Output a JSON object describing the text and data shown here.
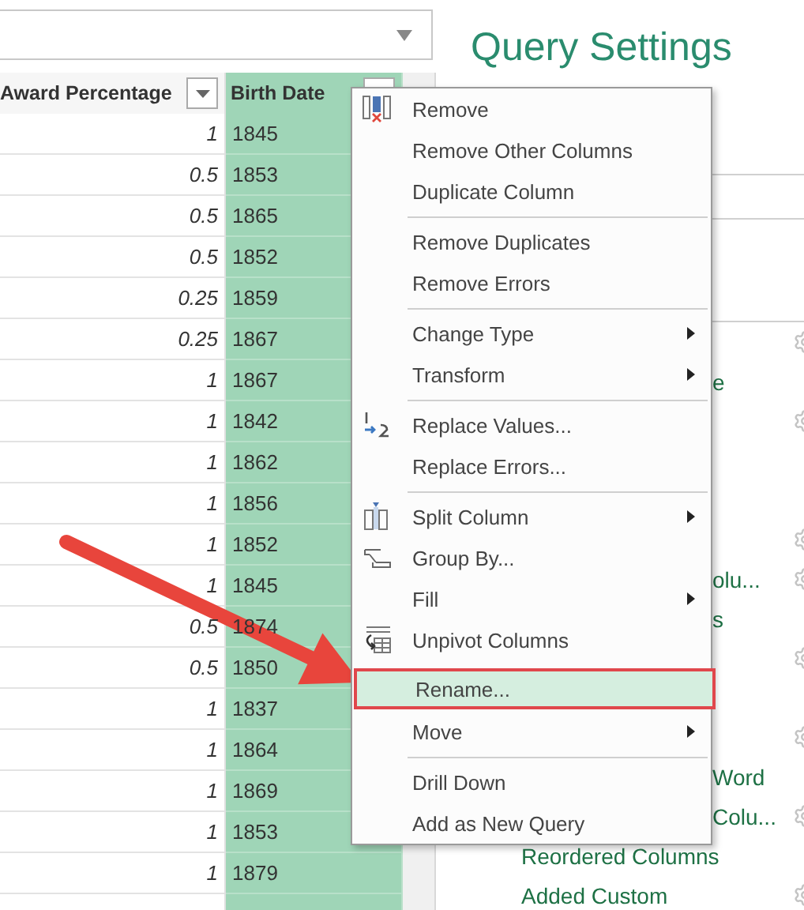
{
  "table": {
    "columns": [
      {
        "label": "Award Percentage",
        "highlighted": false
      },
      {
        "label": "Birth Date",
        "highlighted": true
      }
    ],
    "rows": [
      [
        "1",
        "1845"
      ],
      [
        "0.5",
        "1853"
      ],
      [
        "0.5",
        "1865"
      ],
      [
        "0.5",
        "1852"
      ],
      [
        "0.25",
        "1859"
      ],
      [
        "0.25",
        "1867"
      ],
      [
        "1",
        "1867"
      ],
      [
        "1",
        "1842"
      ],
      [
        "1",
        "1862"
      ],
      [
        "1",
        "1856"
      ],
      [
        "1",
        "1852"
      ],
      [
        "1",
        "1845"
      ],
      [
        "0.5",
        "1874"
      ],
      [
        "0.5",
        "1850"
      ],
      [
        "1",
        "1837"
      ],
      [
        "1",
        "1864"
      ],
      [
        "1",
        "1869"
      ],
      [
        "1",
        "1853"
      ],
      [
        "1",
        "1879"
      ]
    ]
  },
  "query_settings": {
    "title": "Query Settings",
    "steps": [
      {
        "gear": true
      },
      {
        "label": "e",
        "kind": "partial",
        "gear": false
      },
      {
        "gear": true
      },
      {
        "gear": false
      },
      {
        "gear": false
      },
      {
        "gear": true
      },
      {
        "label": "olu...",
        "kind": "partial",
        "gear": true
      },
      {
        "label": "s",
        "kind": "partial",
        "gear": false
      },
      {
        "gear": true
      },
      {
        "gear": false
      },
      {
        "gear": true
      },
      {
        "label": "Word",
        "kind": "partial",
        "gear": false
      },
      {
        "label": "Colu...",
        "kind": "partial",
        "gear": true
      },
      {
        "label": "Reordered Columns",
        "kind": "full",
        "gear": false
      },
      {
        "label": "Added Custom",
        "kind": "full",
        "gear": true
      }
    ]
  },
  "context_menu": {
    "items": [
      {
        "kind": "remove",
        "label": "Remove",
        "submenu": false,
        "selected": false
      },
      {
        "kind": "item",
        "label": "Remove Other Columns",
        "submenu": false,
        "selected": false
      },
      {
        "kind": "item",
        "label": "Duplicate Column",
        "submenu": false,
        "selected": false
      },
      {
        "kind": "separator"
      },
      {
        "kind": "item",
        "label": "Remove Duplicates",
        "submenu": false,
        "selected": false
      },
      {
        "kind": "item",
        "label": "Remove Errors",
        "submenu": false,
        "selected": false
      },
      {
        "kind": "separator"
      },
      {
        "kind": "item",
        "label": "Change Type",
        "submenu": true,
        "selected": false
      },
      {
        "kind": "item",
        "label": "Transform",
        "submenu": true,
        "selected": false
      },
      {
        "kind": "separator"
      },
      {
        "kind": "replace",
        "label": "Replace Values...",
        "submenu": false,
        "selected": false
      },
      {
        "kind": "item",
        "label": "Replace Errors...",
        "submenu": false,
        "selected": false
      },
      {
        "kind": "separator"
      },
      {
        "kind": "split",
        "label": "Split Column",
        "submenu": true,
        "selected": false
      },
      {
        "kind": "group",
        "label": "Group By...",
        "submenu": false,
        "selected": false
      },
      {
        "kind": "item",
        "label": "Fill",
        "submenu": true,
        "selected": false
      },
      {
        "kind": "unpivot",
        "label": "Unpivot Columns",
        "submenu": false,
        "selected": false
      },
      {
        "kind": "item",
        "label": "Rename...",
        "submenu": false,
        "selected": true
      },
      {
        "kind": "item",
        "label": "Move",
        "submenu": true,
        "selected": false
      },
      {
        "kind": "separator"
      },
      {
        "kind": "item",
        "label": "Drill Down",
        "submenu": false,
        "selected": false
      },
      {
        "kind": "item",
        "label": "Add as New Query",
        "submenu": false,
        "selected": false
      }
    ]
  },
  "annotation": {
    "kind": "arrow"
  }
}
